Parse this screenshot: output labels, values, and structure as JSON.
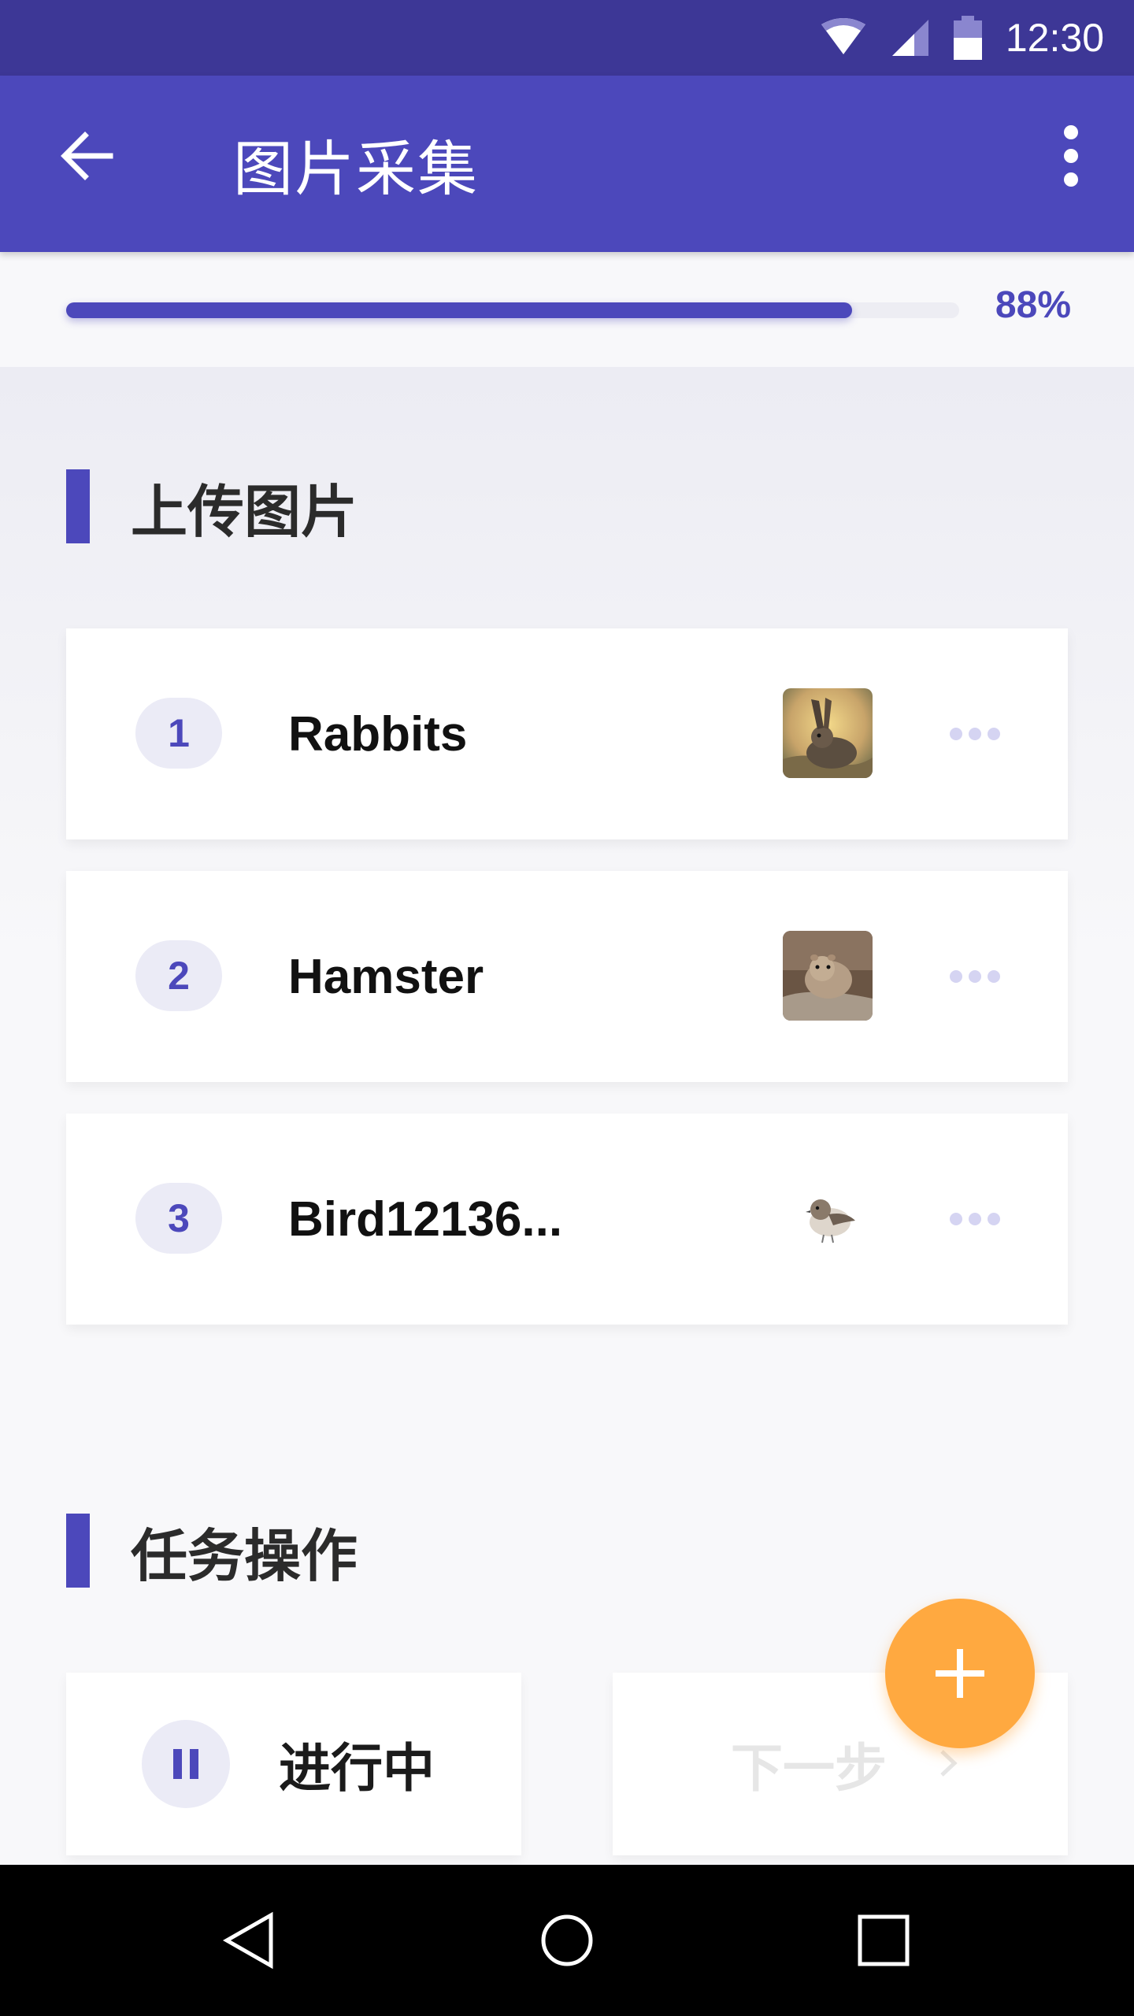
{
  "status_bar": {
    "time": "12:30",
    "icons": [
      "wifi-icon",
      "cell-signal-icon",
      "battery-icon"
    ]
  },
  "app_bar": {
    "title": "图片采集",
    "back_icon": "arrow-left-icon",
    "menu_icon": "more-vertical-icon"
  },
  "progress": {
    "value": 0.88,
    "label": "88%"
  },
  "upload_section": {
    "title": "上传图片",
    "items": [
      {
        "index": "1",
        "name": "Rabbits",
        "thumb": "rabbit-photo"
      },
      {
        "index": "2",
        "name": "Hamster",
        "thumb": "hamster-photo"
      },
      {
        "index": "3",
        "name": "Bird12136...",
        "thumb": "bird-photo"
      }
    ]
  },
  "task_section": {
    "title": "任务操作",
    "status_label": "进行中",
    "next_label": "下一步"
  },
  "fab": {
    "icon": "plus-icon"
  },
  "nav_bar": {
    "icons": [
      "back-triangle-icon",
      "home-circle-icon",
      "recents-square-icon"
    ]
  },
  "colors": {
    "primary": "#4c48bb",
    "status_bar": "#3d3796",
    "fab": "#ffa940"
  }
}
